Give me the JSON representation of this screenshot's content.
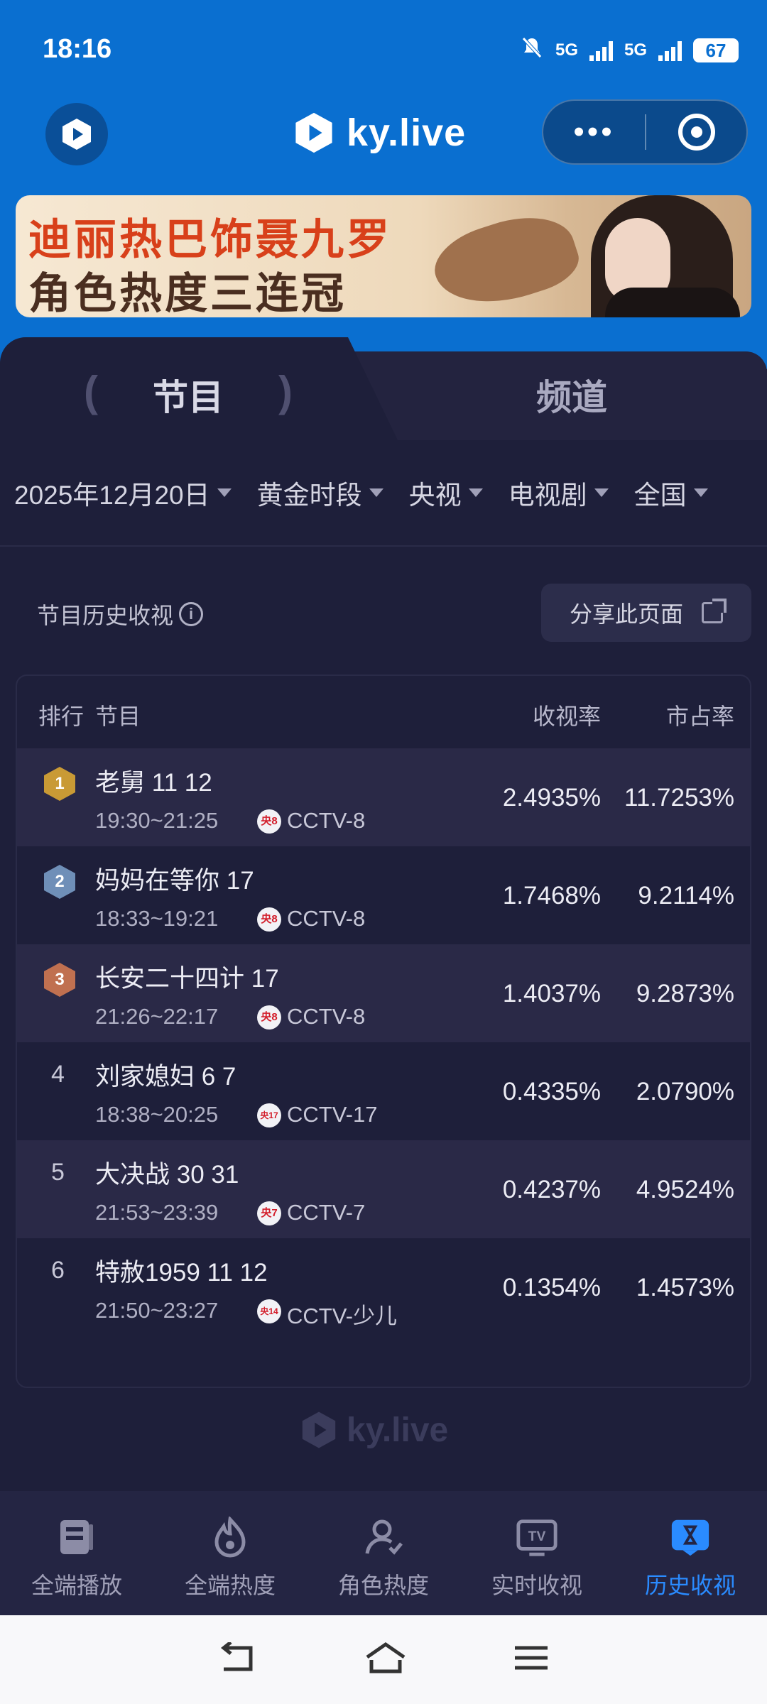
{
  "status": {
    "time": "18:16",
    "net1": "5G",
    "net2": "5G",
    "battery": "67"
  },
  "header": {
    "brand": "ky.live"
  },
  "banner": {
    "line1": "迪丽热巴饰聂九罗",
    "line2": "角色热度三连冠"
  },
  "tabs": [
    {
      "label": "节目",
      "active": true
    },
    {
      "label": "频道",
      "active": false
    }
  ],
  "filters": [
    "2025年12月20日",
    "黄金时段",
    "央视",
    "电视剧",
    "全国"
  ],
  "section": {
    "title": "节目历史收视",
    "share_label": "分享此页面"
  },
  "table": {
    "headers": {
      "rank": "排行",
      "program": "节目",
      "rating": "收视率",
      "share": "市占率"
    },
    "rows": [
      {
        "rank": "1",
        "name": "老舅 11 12",
        "time": "19:30~21:25",
        "channel_badge": "央8",
        "channel": "CCTV-8",
        "rating": "2.4935%",
        "share": "11.7253%"
      },
      {
        "rank": "2",
        "name": "妈妈在等你 17",
        "time": "18:33~19:21",
        "channel_badge": "央8",
        "channel": "CCTV-8",
        "rating": "1.7468%",
        "share": "9.2114%"
      },
      {
        "rank": "3",
        "name": "长安二十四计 17",
        "time": "21:26~22:17",
        "channel_badge": "央8",
        "channel": "CCTV-8",
        "rating": "1.4037%",
        "share": "9.2873%"
      },
      {
        "rank": "4",
        "name": "刘家媳妇 6 7",
        "time": "18:38~20:25",
        "channel_badge": "央17",
        "channel": "CCTV-17",
        "rating": "0.4335%",
        "share": "2.0790%"
      },
      {
        "rank": "5",
        "name": "大决战 30 31",
        "time": "21:53~23:39",
        "channel_badge": "央7",
        "channel": "CCTV-7",
        "rating": "0.4237%",
        "share": "4.9524%"
      },
      {
        "rank": "6",
        "name": "特赦1959 11 12",
        "time": "21:50~23:27",
        "channel_badge": "央14",
        "channel": "CCTV-少儿",
        "rating": "0.1354%",
        "share": "1.4573%"
      }
    ]
  },
  "watermark": "ky.live",
  "bottom_nav": [
    {
      "label": "全端播放",
      "icon": "playlist-icon",
      "active": false
    },
    {
      "label": "全端热度",
      "icon": "flame-icon",
      "active": false
    },
    {
      "label": "角色热度",
      "icon": "person-icon",
      "active": false
    },
    {
      "label": "实时收视",
      "icon": "tv-icon",
      "active": false
    },
    {
      "label": "历史收视",
      "icon": "hourglass-icon",
      "active": true
    }
  ],
  "colors": {
    "header_blue": "#0a6fd0",
    "background": "#1e1f3a",
    "active_blue": "#2a8bff",
    "gold": "#c99a35",
    "silver": "#6f8fb8",
    "bronze": "#c07050"
  }
}
